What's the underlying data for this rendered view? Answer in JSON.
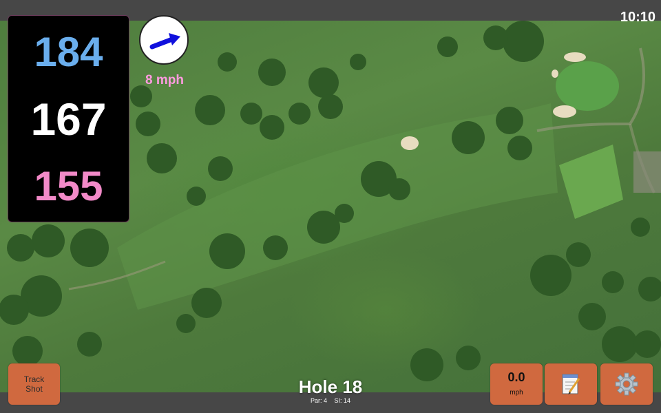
{
  "status_bar": {
    "time": "10:10"
  },
  "yardage": {
    "back": "184",
    "middle": "167",
    "front": "155"
  },
  "wind": {
    "speed": "8 mph",
    "direction_icon": "arrow-icon"
  },
  "buttons": {
    "track_shot_line1": "Track",
    "track_shot_line2": "Shot",
    "wind_value": "0.0",
    "wind_unit": "mph",
    "notes_icon": "notepad-icon",
    "settings_icon": "gear-icon"
  },
  "hole": {
    "title": "Hole 18",
    "par": "Par: 4",
    "si": "SI: 14"
  },
  "colors": {
    "back": "#6aaeed",
    "middle": "#ffffff",
    "front": "#f28ac8",
    "wind_text": "#ff9be0",
    "button": "#d0693f"
  }
}
